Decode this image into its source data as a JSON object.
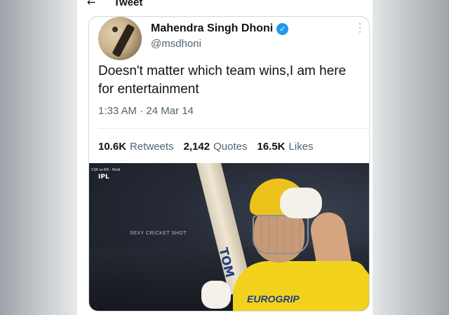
{
  "header": {
    "title": "Tweet"
  },
  "tweet": {
    "author": {
      "name": "Mahendra Singh Dhoni",
      "handle": "@msdhoni"
    },
    "text": "Doesn't matter which team wins,I am here for entertainment",
    "time": "1:33 AM",
    "date": "24 Mar 14",
    "separator": "·",
    "stats": {
      "retweets_count": "10.6K",
      "retweets_label": "Retweets",
      "quotes_count": "2,142",
      "quotes_label": "Quotes",
      "likes_count": "16.5K",
      "likes_label": "Likes"
    },
    "media": {
      "overlay_caption": "CSK vs RR - Hindi",
      "ipl_logo": "IPL",
      "watermark": "SEXY CRICKET SHOT",
      "bat_label": "TOM",
      "shirt_sponsor": "EUROGRIP"
    }
  },
  "colors": {
    "verified": "#1d9bf0",
    "text": "#0f1419",
    "secondary": "#536471"
  },
  "icons": {
    "back": "arrow-left-icon",
    "verified": "verified-badge-icon",
    "more": "more-vertical-icon"
  }
}
